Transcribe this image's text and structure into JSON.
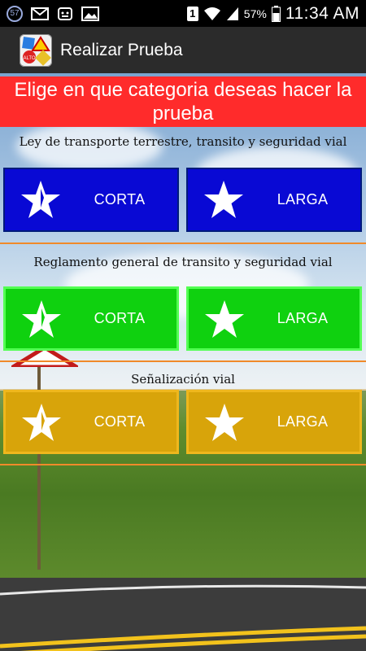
{
  "status_bar": {
    "badge": "57",
    "notification_number": "1",
    "battery_percent": "57%",
    "time": "11:34 AM",
    "icons": [
      "notification-badge-icon",
      "email-icon",
      "android-icon",
      "image-icon",
      "notification-icon",
      "wifi-icon",
      "signal-icon",
      "battery-icon"
    ]
  },
  "action_bar": {
    "title": "Realizar Prueba",
    "app_icon": "road-signs-icon"
  },
  "banner": {
    "text": "Elige en que categoria deseas hacer la prueba"
  },
  "sections": [
    {
      "title": "Ley de transporte terrestre, transito y seguridad vial",
      "short_label": "CORTA",
      "long_label": "LARGA",
      "color": "#0909d4"
    },
    {
      "title": "Reglamento general de transito y seguridad vial",
      "short_label": "CORTA",
      "long_label": "LARGA",
      "color": "#0fd10f"
    },
    {
      "title": "Señalización vial",
      "short_label": "CORTA",
      "long_label": "LARGA",
      "color": "#d8a40a"
    }
  ],
  "colors": {
    "banner": "#ff2b2b",
    "divider": "#f08a2a",
    "action_bar": "#2b2b2b"
  }
}
